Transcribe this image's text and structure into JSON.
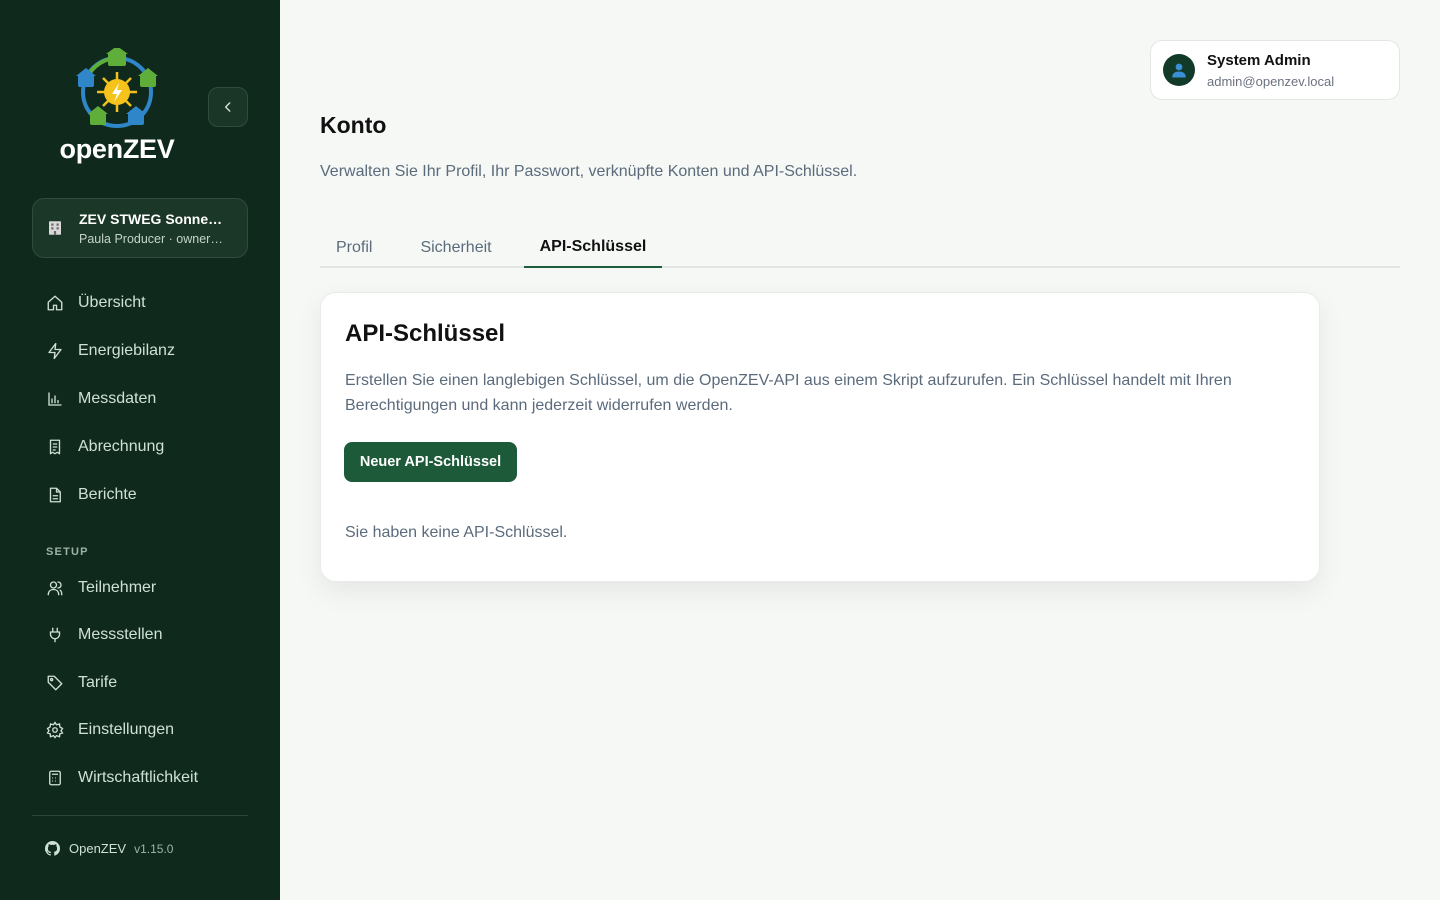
{
  "brand": {
    "name": "openZEV"
  },
  "org": {
    "name": "ZEV STWEG Sonne…",
    "subtitle": "Paula Producer · owner…"
  },
  "nav": {
    "main": [
      {
        "label": "Übersicht",
        "icon": "home-icon"
      },
      {
        "label": "Energiebilanz",
        "icon": "lightning-icon"
      },
      {
        "label": "Messdaten",
        "icon": "bar-chart-icon"
      },
      {
        "label": "Abrechnung",
        "icon": "receipt-icon"
      },
      {
        "label": "Berichte",
        "icon": "document-icon"
      }
    ],
    "section_label": "SETUP",
    "setup": [
      {
        "label": "Teilnehmer",
        "icon": "user-icon"
      },
      {
        "label": "Messstellen",
        "icon": "plug-icon"
      },
      {
        "label": "Tarife",
        "icon": "tag-icon"
      },
      {
        "label": "Einstellungen",
        "icon": "settings-icon"
      },
      {
        "label": "Wirtschaftlichkeit",
        "icon": "calculator-icon"
      }
    ]
  },
  "footer": {
    "app_name": "OpenZEV",
    "version": "v1.15.0"
  },
  "user": {
    "name": "System Admin",
    "email": "admin@openzev.local"
  },
  "page": {
    "title": "Konto",
    "description": "Verwalten Sie Ihr Profil, Ihr Passwort, verknüpfte Konten und API-Schlüssel."
  },
  "tabs": [
    {
      "label": "Profil",
      "active": false
    },
    {
      "label": "Sicherheit",
      "active": false
    },
    {
      "label": "API-Schlüssel",
      "active": true
    }
  ],
  "api_keys": {
    "title": "API-Schlüssel",
    "description": "Erstellen Sie einen langlebigen Schlüssel, um die OpenZEV-API aus einem Skript aufzurufen. Ein Schlüssel handelt mit Ihren Berechtigungen und kann jederzeit widerrufen werden.",
    "new_button": "Neuer API-Schlüssel",
    "empty_text": "Sie haben keine API-Schlüssel."
  },
  "colors": {
    "sidebar_bg": "#10291d",
    "accent": "#1d5a39",
    "page_bg": "#f6f8f6"
  }
}
